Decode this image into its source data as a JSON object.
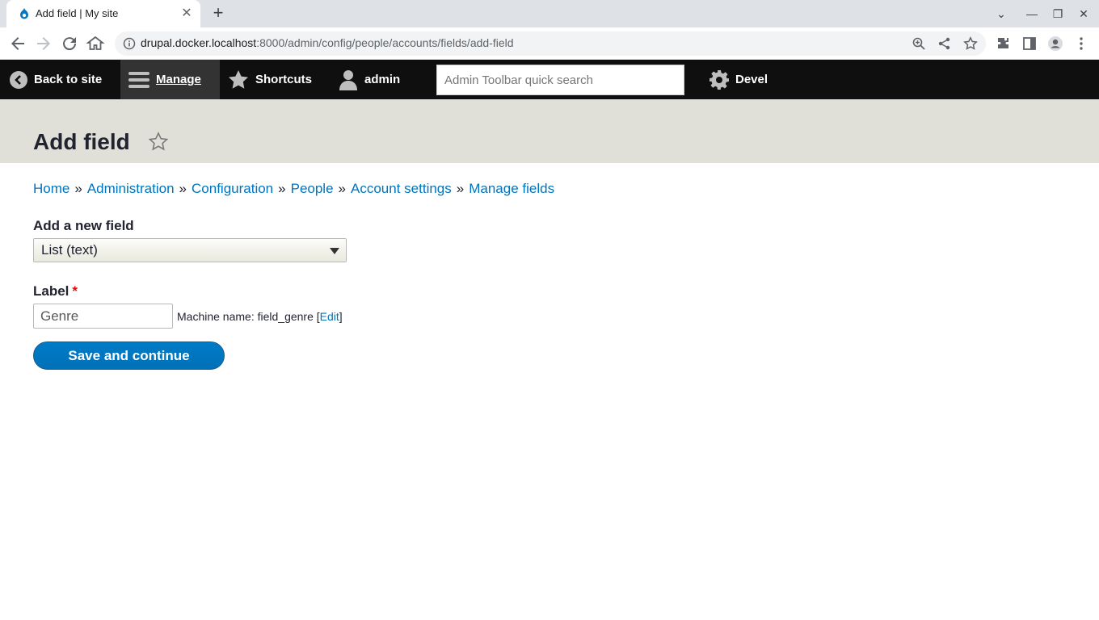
{
  "browser": {
    "tab_title": "Add field | My site",
    "url_host": "drupal.docker.localhost",
    "url_rest": ":8000/admin/config/people/accounts/fields/add-field"
  },
  "admin_toolbar": {
    "back_to_site": "Back to site",
    "manage": "Manage",
    "shortcuts": "Shortcuts",
    "user": "admin",
    "search_placeholder": "Admin Toolbar quick search",
    "devel": "Devel"
  },
  "page": {
    "title": "Add field"
  },
  "breadcrumb": [
    "Home",
    "Administration",
    "Configuration",
    "People",
    "Account settings",
    "Manage fields"
  ],
  "form": {
    "add_field_label": "Add a new field",
    "add_field_value": "List (text)",
    "label_label": "Label",
    "label_required": "*",
    "label_value": "Genre",
    "machine_prefix": "Machine name: field_genre [",
    "machine_edit": "Edit",
    "machine_suffix": "]",
    "submit": "Save and continue"
  },
  "colors": {
    "link": "#0074bd",
    "toolbar_bg": "#0f0f0f",
    "header_bg": "#e0e0d8",
    "button_bg": "#0074bd"
  }
}
